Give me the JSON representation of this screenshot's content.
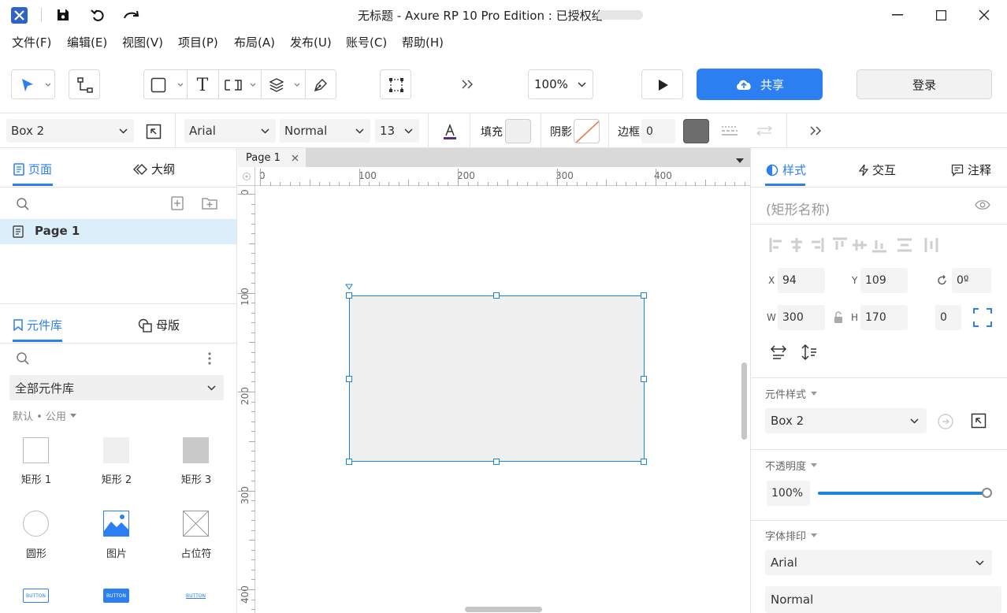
{
  "window": {
    "title": "无标题 - Axure RP 10 Pro Edition : 已授权给"
  },
  "menu": [
    "文件(F)",
    "编辑(E)",
    "视图(V)",
    "项目(P)",
    "布局(A)",
    "发布(U)",
    "账号(C)",
    "帮助(H)"
  ],
  "toolbar": {
    "zoom": "100%",
    "share_label": "共享",
    "login_label": "登录"
  },
  "formatbar": {
    "element_name": "Box 2",
    "font": "Arial",
    "weight": "Normal",
    "size": "13",
    "fill_label": "填充",
    "shadow_label": "阴影",
    "border_label": "边框",
    "border_value": "0"
  },
  "left": {
    "tab_pages": "页面",
    "tab_outline": "大纲",
    "page_item": "Page 1",
    "tab_library": "元件库",
    "tab_masters": "母版",
    "library_select": "全部元件库",
    "library_sub": "默认 • 公用",
    "widgets": [
      "矩形 1",
      "矩形 2",
      "矩形 3",
      "圆形",
      "图片",
      "占位符"
    ],
    "buttons": [
      "BUTTON",
      "BUTTON",
      "BUTTON"
    ]
  },
  "canvas": {
    "tab": "Page 1",
    "hruler": [
      "0",
      "100",
      "200",
      "300",
      "400"
    ],
    "vruler": [
      "0",
      "100",
      "200",
      "300",
      "400"
    ]
  },
  "right": {
    "tab_style": "样式",
    "tab_interact": "交互",
    "tab_notes": "注释",
    "shape_name_placeholder": "(矩形名称)",
    "x": "94",
    "y": "109",
    "rot": "0º",
    "w": "300",
    "h": "170",
    "radius": "0",
    "style_label": "元件样式",
    "style_value": "Box 2",
    "opacity_label": "不透明度",
    "opacity_value": "100%",
    "opacity_fraction": 1.0,
    "font_label": "字体排印",
    "font_value": "Arial",
    "font_weight": "Normal"
  },
  "colors": {
    "accent": "#2b7ff0",
    "selection": "#1a86d8",
    "shape_fill": "#f0f0f0"
  }
}
